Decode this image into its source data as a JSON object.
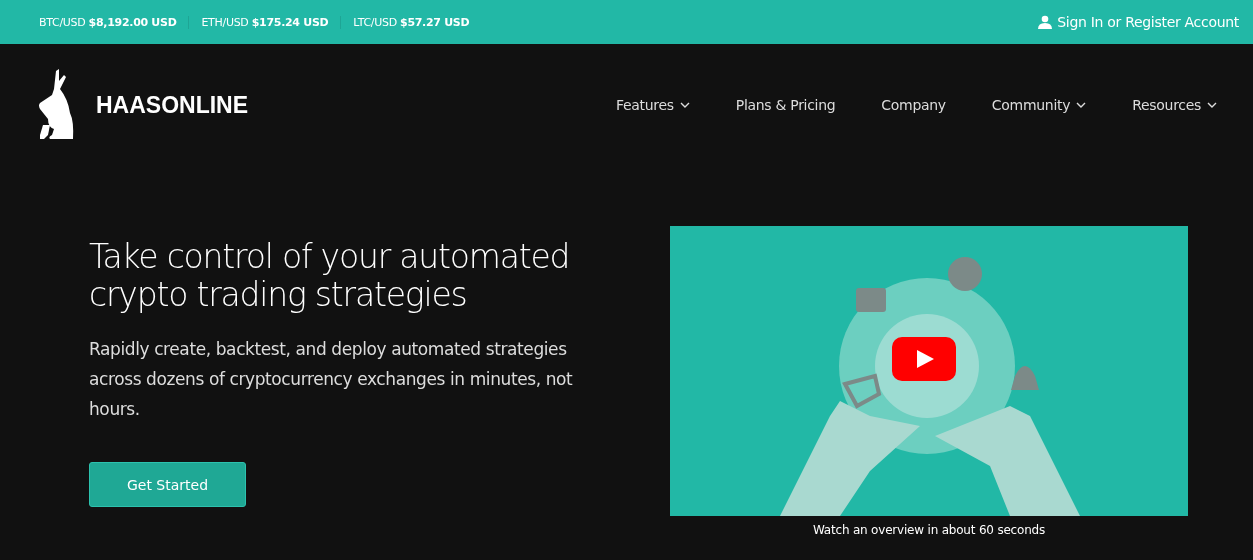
{
  "ticker": [
    {
      "text": "BTC/USD **$8,192.00 USD**"
    },
    {
      "text": "ETH/USD **$175.24 USD**"
    },
    {
      "text": "LTC/USD **$57.27 USD**"
    }
  ],
  "account_link": "Sign In or Register Account",
  "logo": {
    "text": "HAASONLINE"
  },
  "nav": [
    {
      "label": "Features",
      "dropdown": true
    },
    {
      "label": "Plans & Pricing",
      "dropdown": false
    },
    {
      "label": "Company",
      "dropdown": false
    },
    {
      "label": "Community",
      "dropdown": true
    },
    {
      "label": "Resources",
      "dropdown": true
    }
  ],
  "hero": {
    "title": "Take control of your automated crypto trading strategies",
    "subtitle": "Rapidly create, backtest, and deploy automated strategies across dozens of cryptocurrency exchanges in minutes, not hours.",
    "button": "Get Started"
  },
  "video": {
    "kind": "picture",
    "caption": "Watch an overview in about 60 seconds"
  }
}
